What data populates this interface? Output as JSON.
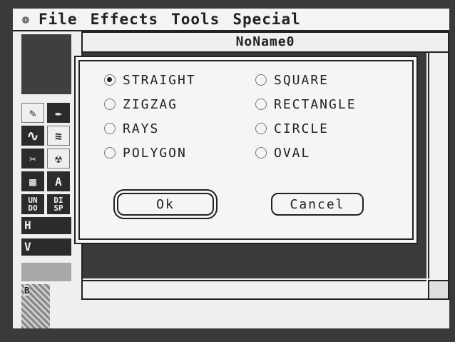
{
  "menubar": {
    "apple_icon": "apple-icon",
    "items": [
      "File",
      "Effects",
      "Tools",
      "Special"
    ]
  },
  "document": {
    "title": "NoName0"
  },
  "toolbox": {
    "undo_label": [
      "UN",
      "DO"
    ],
    "disp_label": [
      "DI",
      "SP"
    ],
    "text_tool_label": "A",
    "h_label": "H",
    "v_label": "V",
    "pattern_label": "B"
  },
  "dialog": {
    "left_options": [
      "STRAIGHT",
      "ZIGZAG",
      "RAYS",
      "POLYGON"
    ],
    "right_options": [
      "SQUARE",
      "RECTANGLE",
      "CIRCLE",
      "OVAL"
    ],
    "selected": "STRAIGHT",
    "ok_label": "Ok",
    "cancel_label": "Cancel"
  },
  "colors": {
    "dark": "#2b2b2b",
    "background": "#efefef",
    "canvas": "#3a3a3a"
  }
}
